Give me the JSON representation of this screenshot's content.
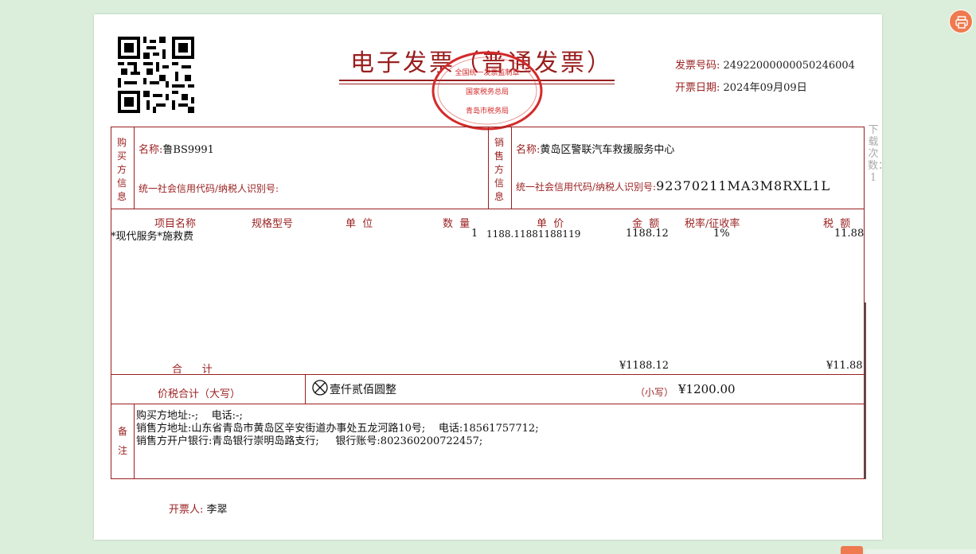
{
  "invoice": {
    "title": "电子发票（普通发票）",
    "invoice_no_label": "发票号码:",
    "invoice_no": "24922000000050246004",
    "date_label": "开票日期:",
    "date": "2024年09月09日",
    "seal_text_top": "全国统一发票监制章",
    "seal_text_mid": "国家税务总局",
    "seal_text_bottom": "青岛市税务局"
  },
  "buyer": {
    "section": "购买方信息",
    "name_label": "名称:",
    "name": "鲁BS9991",
    "tax_label": "统一社会信用代码/纳税人识别号:",
    "tax_id": ""
  },
  "seller": {
    "section": "销售方信息",
    "name_label": "名称:",
    "name": "黄岛区警联汽车救援服务中心",
    "tax_label": "统一社会信用代码/纳税人识别号:",
    "tax_id": "92370211MA3M8RXL1L"
  },
  "table": {
    "headers": {
      "item_name": "项目名称",
      "spec": "规格型号",
      "unit": "单  位",
      "qty": "数  量",
      "price": "单  价",
      "amount": "金  额",
      "rate": "税率/征收率",
      "tax": "税  额"
    },
    "rows": [
      {
        "item_name": "*现代服务*施救费",
        "spec": "",
        "unit": "",
        "qty": "1",
        "price": "1188.11881188119",
        "amount": "1188.12",
        "rate": "1%",
        "tax": "11.88"
      }
    ]
  },
  "total": {
    "label": "合      计",
    "amount": "¥1188.12",
    "tax": "¥11.88"
  },
  "grand_total": {
    "label": "价税合计（大写）",
    "uppercase": "壹仟贰佰圆整",
    "small_label": "（小写）",
    "small": "¥1200.00"
  },
  "remarks": {
    "section": "备注",
    "line1": "购买方地址:-;    电话:-;",
    "line2": "销售方地址:山东省青岛市黄岛区辛安街道办事处五龙河路10号;    电话:18561757712;",
    "line3": "销售方开户银行:青岛银行崇明岛路支行;     银行账号:802360200722457;"
  },
  "issuer": {
    "label": "开票人:",
    "name": "李翠"
  },
  "side_note": "下载次数：1",
  "colors": {
    "accent": "#9a1f1f",
    "page_bg": "#dbeedb",
    "button": "#ef7a4f"
  },
  "icons": {
    "print": "printer-icon",
    "uppercase_mark": "circle-x-icon"
  }
}
